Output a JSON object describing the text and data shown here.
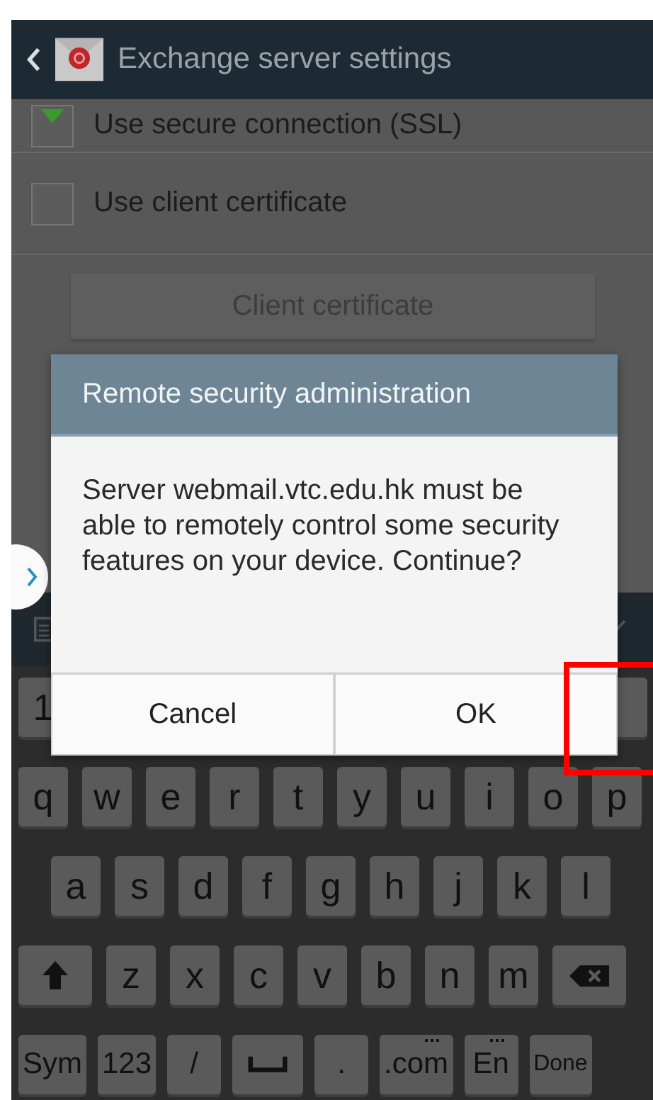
{
  "app_bar": {
    "title": "Exchange server settings"
  },
  "settings": [
    {
      "kind": "checkbox",
      "label": "Use secure connection (SSL)",
      "checked": true
    },
    {
      "kind": "checkbox",
      "label": "Use client certificate",
      "checked": false
    },
    {
      "kind": "button",
      "label": "Client certificate",
      "disabled": true
    }
  ],
  "dialog": {
    "title": "Remote security administration",
    "message": "Server webmail.vtc.edu.hk must be able to remotely control some security features on your device. Continue?",
    "buttons": [
      {
        "label": "Cancel",
        "highlighted": false
      },
      {
        "label": "OK",
        "highlighted": true
      }
    ]
  },
  "keyboard": {
    "number_row": {
      "first": "1"
    },
    "letter_rows": [
      [
        "q",
        "w",
        "e",
        "r",
        "t",
        "y",
        "u",
        "i",
        "o",
        "p"
      ],
      [
        "a",
        "s",
        "d",
        "f",
        "g",
        "h",
        "j",
        "k",
        "l"
      ],
      [
        "z",
        "x",
        "c",
        "v",
        "b",
        "n",
        "m"
      ]
    ],
    "bottom_row": [
      {
        "kind": "text",
        "label": "Sym"
      },
      {
        "kind": "text",
        "label": "123"
      },
      {
        "kind": "text",
        "label": "/"
      },
      {
        "kind": "space"
      },
      {
        "kind": "text",
        "label": "."
      },
      {
        "kind": "dots",
        "label": ".com"
      },
      {
        "kind": "dots",
        "label": "En"
      },
      {
        "kind": "small",
        "label": "Done"
      }
    ]
  }
}
